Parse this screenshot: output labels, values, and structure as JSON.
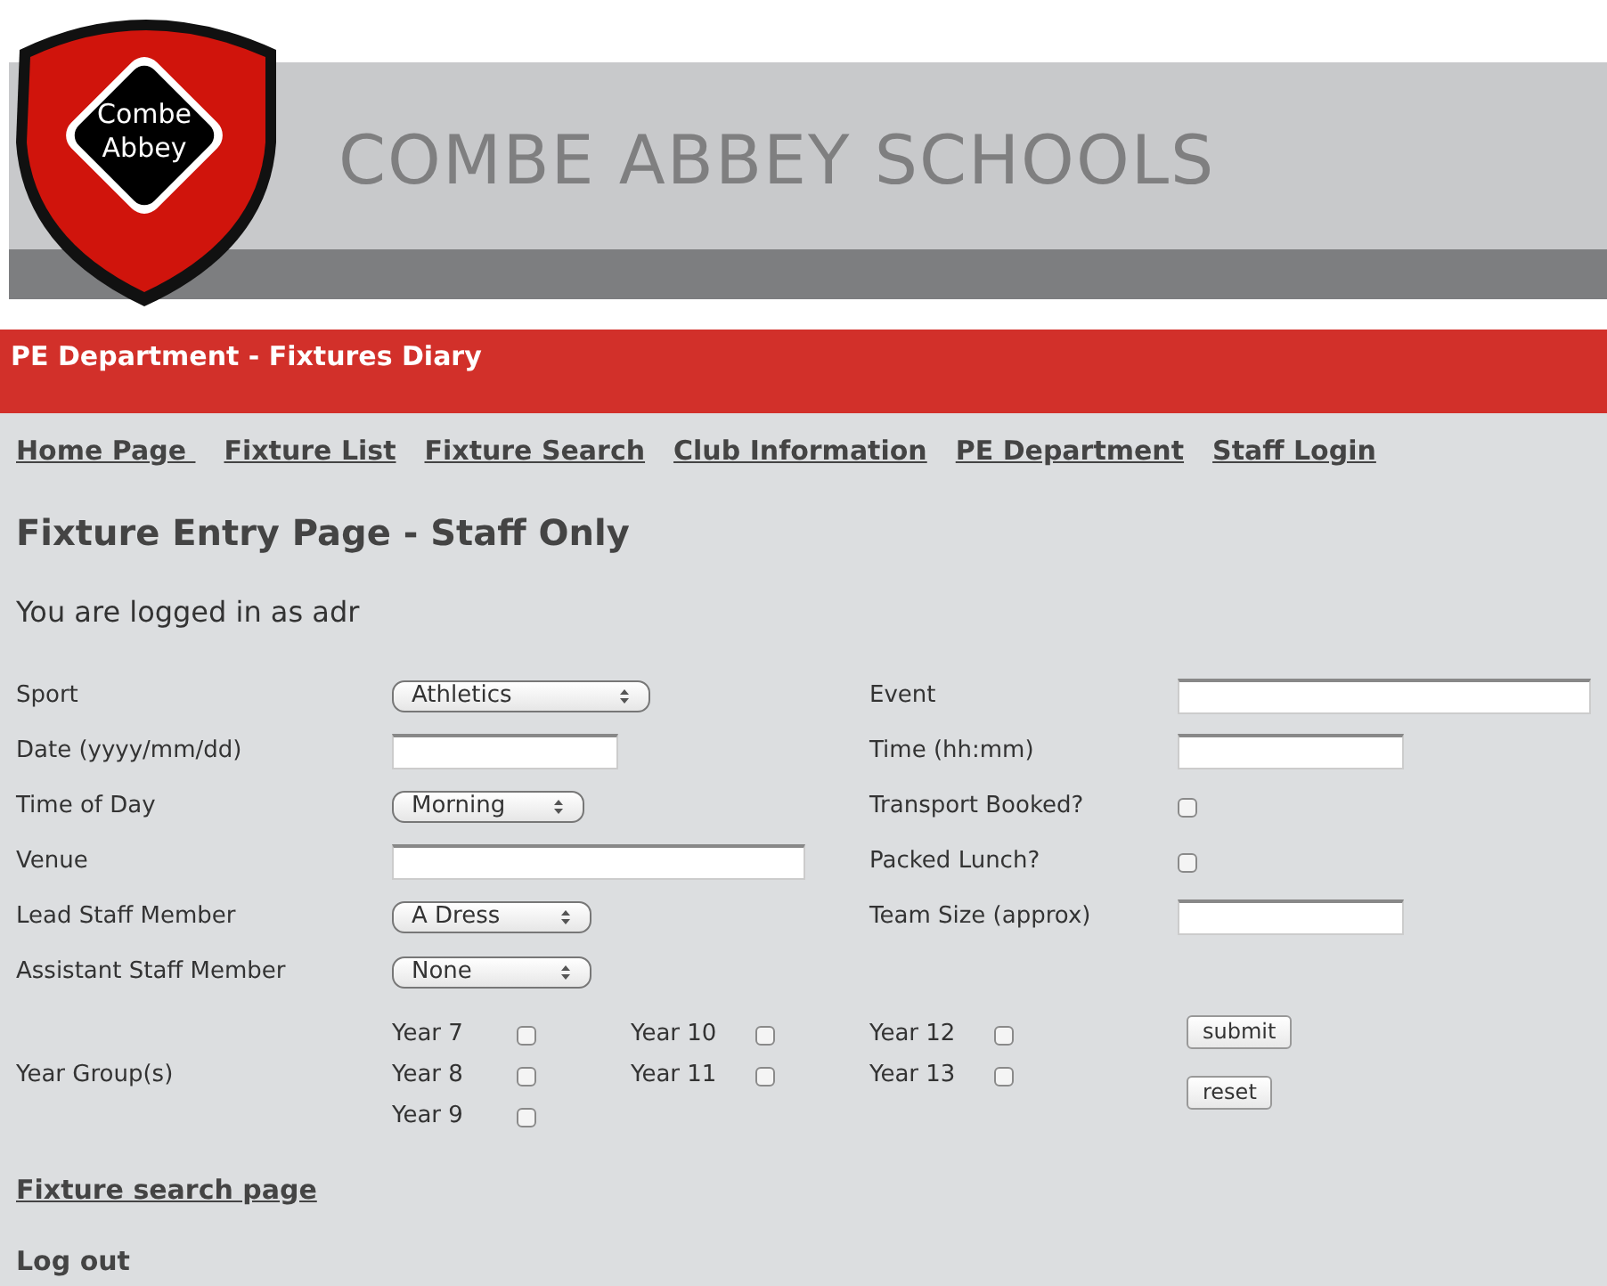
{
  "logo": {
    "lines": [
      "Combe",
      "Abbey"
    ]
  },
  "site_title": "COMBE ABBEY SCHOOLS",
  "banner": "PE Department - Fixtures Diary",
  "nav": [
    "Home Page ",
    "Fixture List",
    "Fixture Search",
    "Club Information",
    "PE Department",
    "Staff Login"
  ],
  "heading": "Fixture Entry Page - Staff Only",
  "login_text": "You are logged in as adr",
  "left_fields": [
    {
      "label": "Sport",
      "kind": "select",
      "value": "Athletics"
    },
    {
      "label": "Date (yyyy/mm/dd)",
      "kind": "text"
    },
    {
      "label": "Time of Day",
      "kind": "select",
      "value": "Morning"
    },
    {
      "label": "Venue",
      "kind": "text"
    },
    {
      "label": "Lead Staff Member",
      "kind": "select",
      "value": "A Dress"
    },
    {
      "label": "Assistant Staff Member",
      "kind": "select",
      "value": "None"
    }
  ],
  "right_fields": [
    {
      "label": "Event",
      "kind": "text"
    },
    {
      "label": "Time (hh:mm)",
      "kind": "text"
    },
    {
      "label": "Transport Booked?",
      "kind": "checkbox",
      "checked": false
    },
    {
      "label": "Packed Lunch?",
      "kind": "checkbox",
      "checked": false
    },
    {
      "label": "Team Size (approx)",
      "kind": "text"
    }
  ],
  "year_groups": {
    "label": "Year Group(s)",
    "columns": [
      [
        {
          "label": "Year 7",
          "checked": false
        },
        {
          "label": "Year 8",
          "checked": false
        },
        {
          "label": "Year 9",
          "checked": false
        }
      ],
      [
        {
          "label": "Year 10",
          "checked": false
        },
        {
          "label": "Year 11",
          "checked": false
        }
      ],
      [
        {
          "label": "Year 12",
          "checked": false
        },
        {
          "label": "Year 13",
          "checked": false
        }
      ]
    ]
  },
  "buttons": [
    "submit",
    "reset"
  ],
  "links": [
    "Fixture search page",
    "Log out"
  ]
}
